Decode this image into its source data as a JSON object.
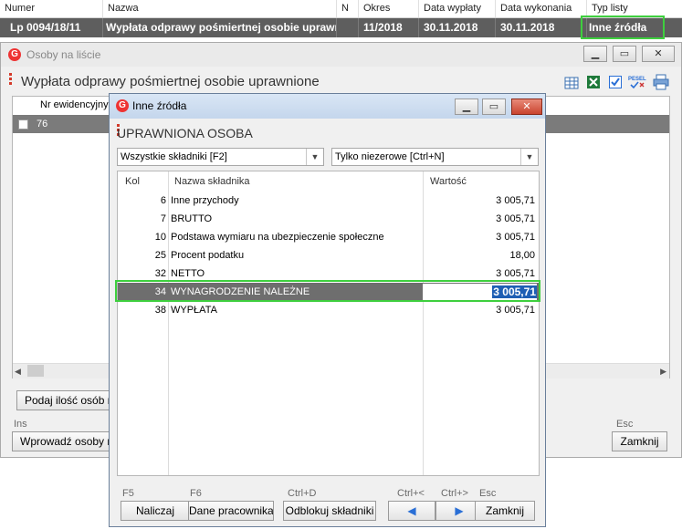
{
  "top_list": {
    "headers": [
      "Numer",
      "Nazwa",
      "N",
      "Okres",
      "Data wypłaty",
      "Data wykonania",
      "Typ listy"
    ],
    "row": {
      "numer": "Lp 0094/18/11",
      "nazwa": "Wypłata odprawy pośmiertnej osobie uprawni",
      "n": "",
      "okres": "11/2018",
      "data_wyplaty": "30.11.2018",
      "data_wykonania": "30.11.2018",
      "typ_listy": "Inne źródła"
    }
  },
  "bg_window": {
    "title": "Osoby na liście",
    "heading": "Wypłata odprawy pośmiertnej osobie uprawnione",
    "column_header": "Nr ewidencyjny",
    "row_value": "76",
    "btn_podaj": "Podaj ilość osób na",
    "hint_ins": "Ins",
    "btn_wprowadz": "Wprowadź osoby na",
    "hint_esc": "Esc",
    "btn_zamknij": "Zamknij"
  },
  "dialog": {
    "title": "Inne źródła",
    "heading": "UPRAWNIONA OSOBA",
    "select_left": "Wszystkie składniki [F2]",
    "select_right": "Tylko niezerowe [Ctrl+N]",
    "columns": {
      "kol": "Kol",
      "name": "Nazwa składnika",
      "value": "Wartość"
    },
    "rows": [
      {
        "kol": "6",
        "name": "Inne przychody",
        "value": "3 005,71"
      },
      {
        "kol": "7",
        "name": "BRUTTO",
        "value": "3 005,71"
      },
      {
        "kol": "10",
        "name": "Podstawa wymiaru na ubezpieczenie społeczne",
        "value": "3 005,71"
      },
      {
        "kol": "25",
        "name": "Procent podatku",
        "value": "18,00"
      },
      {
        "kol": "32",
        "name": "NETTO",
        "value": "3 005,71"
      },
      {
        "kol": "34",
        "name": "WYNAGRODZENIE NALEŻNE",
        "value": "3 005,71"
      },
      {
        "kol": "38",
        "name": "WYPŁATA",
        "value": "3 005,71"
      }
    ],
    "footer": {
      "hint_f5": "F5",
      "btn_naliczaj": "Naliczaj",
      "hint_f6": "F6",
      "btn_dane": "Dane pracownika",
      "hint_ctrld": "Ctrl+D",
      "btn_odblokuj": "Odblokuj składniki",
      "hint_ctrl_prev": "Ctrl+<",
      "hint_ctrl_next": "Ctrl+>",
      "hint_esc": "Esc",
      "btn_zamknij": "Zamknij"
    }
  },
  "colors": {
    "highlight": "#3ecf3e",
    "selected_row": "#5e5e5e",
    "accent_red": "#d43a2a",
    "blue_arrow": "#2a6fd6"
  },
  "icons": [
    "table-icon",
    "excel-icon",
    "check-icon",
    "pesel-icon",
    "print-icon",
    "g-app-icon"
  ]
}
